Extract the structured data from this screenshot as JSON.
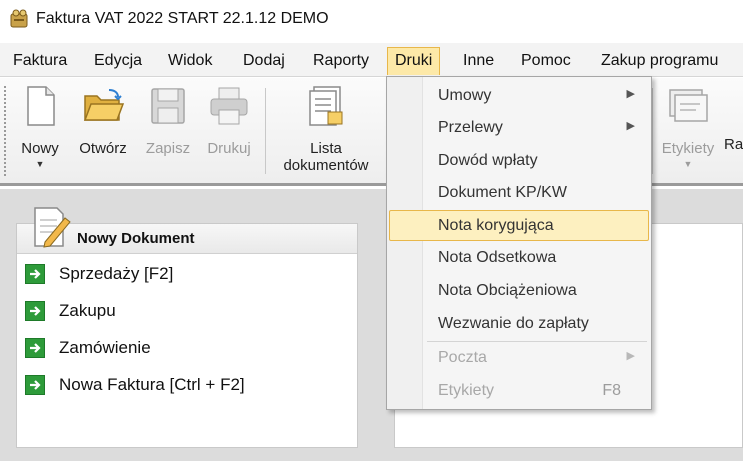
{
  "window": {
    "title": "Faktura VAT 2022 START 22.1.12 DEMO",
    "icon": "app-logo-icon"
  },
  "menubar": {
    "items": [
      {
        "label": "Faktura",
        "active": false
      },
      {
        "label": "Edycja",
        "active": false
      },
      {
        "label": "Widok",
        "active": false
      },
      {
        "label": "Dodaj",
        "active": false
      },
      {
        "label": "Raporty",
        "active": false
      },
      {
        "label": "Druki",
        "active": true
      },
      {
        "label": "Inne",
        "active": false
      },
      {
        "label": "Pomoc",
        "active": false
      },
      {
        "label": "Zakup programu",
        "active": false
      }
    ]
  },
  "toolbar": {
    "new": {
      "label": "Nowy",
      "icon": "new-document-icon",
      "has_dropdown": true
    },
    "open": {
      "label": "Otwórz",
      "icon": "folder-open-icon"
    },
    "save": {
      "label": "Zapisz",
      "icon": "floppy-disk-icon",
      "disabled": true
    },
    "print": {
      "label": "Drukuj",
      "icon": "printer-icon",
      "disabled": true
    },
    "list": {
      "label_line1": "Lista",
      "label_line2": "dokumentów",
      "icon": "document-list-icon"
    },
    "labels": {
      "label": "Etykiety",
      "icon": "labels-icon",
      "has_dropdown": true
    },
    "cut_label": "Ra"
  },
  "panel": {
    "title": "Nowy Dokument",
    "icon": "pencil-document-icon",
    "items": [
      {
        "label": "Sprzedaży [F2]",
        "icon": "green-arrow-icon"
      },
      {
        "label": "Zakupu",
        "icon": "green-arrow-icon"
      },
      {
        "label": "Zamówienie",
        "icon": "green-arrow-icon"
      },
      {
        "label": "Nowa Faktura [Ctrl + F2]",
        "icon": "green-arrow-icon"
      }
    ]
  },
  "dropdown": {
    "items": [
      {
        "label": "Umowy",
        "submenu": true,
        "disabled": false,
        "highlight": false
      },
      {
        "label": "Przelewy",
        "submenu": true,
        "disabled": false,
        "highlight": false
      },
      {
        "label": "Dowód wpłaty",
        "submenu": false,
        "disabled": false,
        "highlight": false
      },
      {
        "label": "Dokument KP/KW",
        "submenu": false,
        "disabled": false,
        "highlight": false
      },
      {
        "label": "Nota korygująca",
        "submenu": false,
        "disabled": false,
        "highlight": true
      },
      {
        "label": "Nota Odsetkowa",
        "submenu": false,
        "disabled": false,
        "highlight": false
      },
      {
        "label": "Nota Obciążeniowa",
        "submenu": false,
        "disabled": false,
        "highlight": false
      },
      {
        "label": "Wezwanie do zapłaty",
        "submenu": false,
        "disabled": false,
        "highlight": false
      },
      {
        "label": "Poczta",
        "submenu": true,
        "disabled": true,
        "highlight": false
      },
      {
        "label": "Etykiety",
        "submenu": false,
        "disabled": true,
        "highlight": false,
        "shortcut": "F8"
      }
    ]
  },
  "colors": {
    "highlight_bg": "#fdf0c0",
    "highlight_border": "#e8b74a",
    "arrow_green": "#2e9b3a"
  }
}
